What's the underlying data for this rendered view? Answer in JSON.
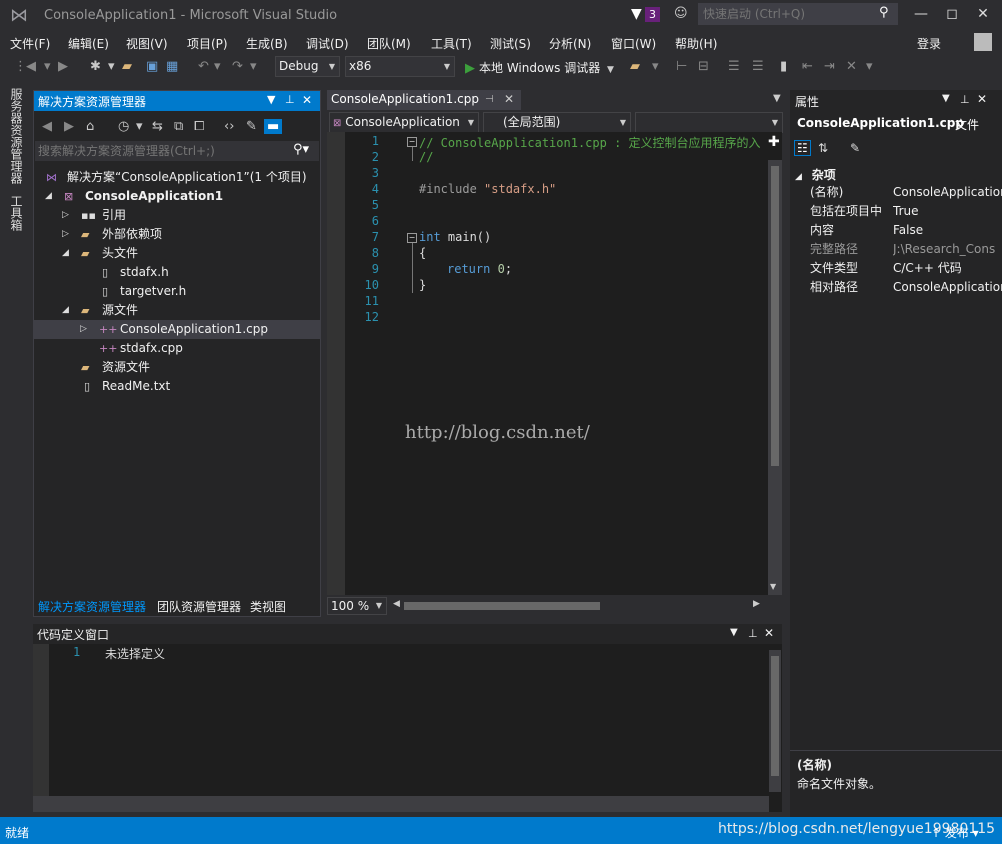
{
  "window": {
    "title": "ConsoleApplication1 - Microsoft Visual Studio",
    "notification_count": "3",
    "quick_launch_placeholder": "快速启动 (Ctrl+Q)",
    "login": "登录"
  },
  "menu": [
    "文件(F)",
    "编辑(E)",
    "视图(V)",
    "项目(P)",
    "生成(B)",
    "调试(D)",
    "团队(M)",
    "工具(T)",
    "测试(S)",
    "分析(N)",
    "窗口(W)",
    "帮助(H)"
  ],
  "toolbar": {
    "configuration": "Debug",
    "platform": "x86",
    "run_label": "本地 Windows 调试器"
  },
  "side_tabs": [
    "服务器资源管理器",
    "工具箱"
  ],
  "solution_explorer": {
    "title": "解决方案资源管理器",
    "search_placeholder": "搜索解决方案资源管理器(Ctrl+;)",
    "tree": [
      {
        "label": "解决方案“ConsoleApplication1”(1 个项目)",
        "icon": "solution-icon",
        "depth": 0
      },
      {
        "label": "ConsoleApplication1",
        "icon": "project-icon",
        "depth": 1,
        "bold": true
      },
      {
        "label": "引用",
        "icon": "references-icon",
        "depth": 2
      },
      {
        "label": "外部依赖项",
        "icon": "folder-icon",
        "depth": 2
      },
      {
        "label": "头文件",
        "icon": "folder-icon",
        "depth": 2
      },
      {
        "label": "stdafx.h",
        "icon": "file-icon",
        "depth": 3
      },
      {
        "label": "targetver.h",
        "icon": "file-icon",
        "depth": 3
      },
      {
        "label": "源文件",
        "icon": "folder-icon",
        "depth": 2
      },
      {
        "label": "ConsoleApplication1.cpp",
        "icon": "cpp-file-icon",
        "depth": 3
      },
      {
        "label": "stdafx.cpp",
        "icon": "cpp-file-icon",
        "depth": 3
      },
      {
        "label": "资源文件",
        "icon": "folder-icon",
        "depth": 2
      },
      {
        "label": "ReadMe.txt",
        "icon": "file-icon",
        "depth": 2
      }
    ],
    "bottom_tabs": [
      "解决方案资源管理器",
      "团队资源管理器",
      "类视图"
    ]
  },
  "editor": {
    "tab_label": "ConsoleApplication1.cpp",
    "nav_project": "ConsoleApplication",
    "nav_scope": "(全局范围)",
    "line_numbers": [
      "1",
      "2",
      "3",
      "4",
      "5",
      "6",
      "7",
      "8",
      "9",
      "10",
      "11",
      "12"
    ],
    "code": {
      "line1": "// ConsoleApplication1.cpp : 定义控制台应用程序的入",
      "line2": "//",
      "line4_pp": "#include",
      "line4_str": "\"stdafx.h\"",
      "line7_kw": "int",
      "line7_rest": " main()",
      "line8": "{",
      "line9_kw": "return",
      "line9_num": "0",
      "line9_end": ";",
      "line10": "}"
    },
    "watermark": "http://blog.csdn.net/",
    "zoom": "100 %"
  },
  "properties": {
    "title": "属性",
    "object_name": "ConsoleApplication1.cpp",
    "object_type": "文件",
    "category": "杂项",
    "rows": [
      {
        "key": "(名称)",
        "value": "ConsoleApplication"
      },
      {
        "key": "包括在项目中",
        "value": "True"
      },
      {
        "key": "内容",
        "value": "False"
      },
      {
        "key": "完整路径",
        "value": "J:\\Research_Cons"
      },
      {
        "key": "文件类型",
        "value": "C/C++ 代码"
      },
      {
        "key": "相对路径",
        "value": "ConsoleApplication"
      }
    ],
    "desc_title": "(名称)",
    "desc_text": "命名文件对象。"
  },
  "code_definition": {
    "title": "代码定义窗口",
    "line_number": "1",
    "content": "未选择定义"
  },
  "status": {
    "text": "就绪",
    "url": "https://blog.csdn.net/lengyue19980115",
    "publish": "↑ 发布 ▾"
  },
  "colors": {
    "accent": "#007acc",
    "background": "#2d2d30",
    "editor": "#1e1e1e",
    "panel": "#252526"
  }
}
